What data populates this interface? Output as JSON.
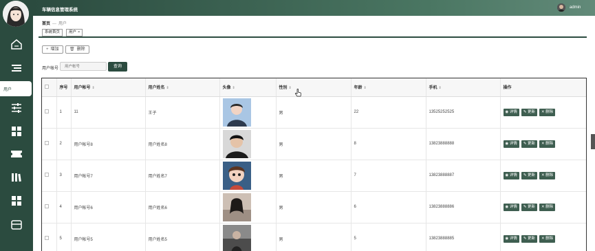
{
  "app": {
    "title": "车辆信息管理系统",
    "user": "admin"
  },
  "sidebar": {
    "icons": [
      "home-icon",
      "menu-list-icon",
      "sliders-icon",
      "grid-icon",
      "ticket-icon",
      "library-icon",
      "apps-icon",
      "card-icon"
    ],
    "active_label": "用户"
  },
  "breadcrumb": {
    "home": "首页",
    "separator": "—",
    "current": "用户"
  },
  "tabs": [
    {
      "label": "系统首页"
    },
    {
      "label": "用户"
    }
  ],
  "tab_close_glyph": "×",
  "toolbar": {
    "add_label": "增加",
    "delete_label": "删除"
  },
  "filter": {
    "label": "用户帐号",
    "placeholder": "用户帐号",
    "query_label": "查询"
  },
  "table": {
    "columns": [
      "序号",
      "用户帐号",
      "用户姓名",
      "头像",
      "性别",
      "年龄",
      "手机",
      "操作"
    ],
    "actions": [
      "详情",
      "更新",
      "删除"
    ],
    "rows": [
      {
        "index": "1",
        "account": "11",
        "name": "王子",
        "gender": "男",
        "age": "22",
        "phone": "13525252525"
      },
      {
        "index": "2",
        "account": "用户帐号8",
        "name": "用户姓名8",
        "gender": "男",
        "age": "8",
        "phone": "13823888888"
      },
      {
        "index": "3",
        "account": "用户帐号7",
        "name": "用户姓名7",
        "gender": "男",
        "age": "7",
        "phone": "13823888887"
      },
      {
        "index": "4",
        "account": "用户帐号6",
        "name": "用户姓名6",
        "gender": "男",
        "age": "6",
        "phone": "13823888886"
      },
      {
        "index": "5",
        "account": "用户帐号5",
        "name": "用户姓名5",
        "gender": "男",
        "age": "5",
        "phone": "13823888885"
      }
    ]
  },
  "colors": {
    "primary": "#2b4b3f",
    "button": "#3e5e50"
  }
}
